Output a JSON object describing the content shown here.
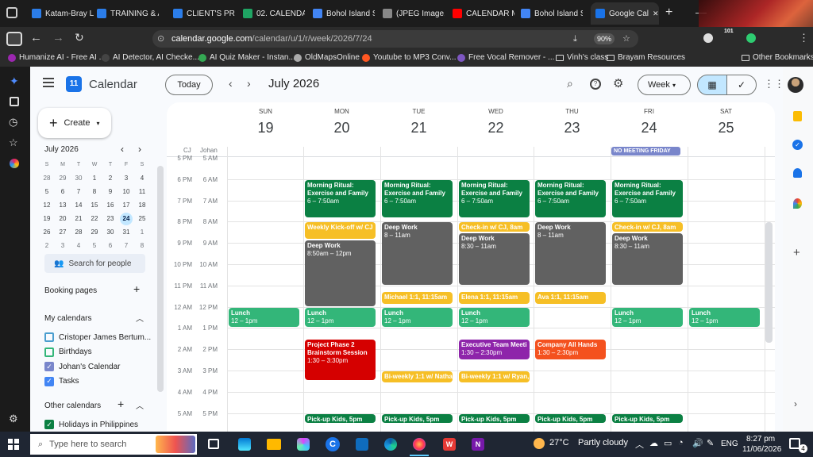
{
  "browser": {
    "tabs": [
      {
        "label": "Katam-Bray La",
        "color": "#2b7de9"
      },
      {
        "label": "TRAINING & A",
        "color": "#2b7de9"
      },
      {
        "label": "CLIENT'S PRO",
        "color": "#2b7de9"
      },
      {
        "label": "02. CALENDAR",
        "color": "#1fa463"
      },
      {
        "label": "Bohol Island S",
        "color": "#4285f4"
      },
      {
        "label": "(JPEG Image, 1024",
        "color": "#888888"
      },
      {
        "label": "CALENDAR M",
        "color": "#ff0000"
      },
      {
        "label": "Bohol Island S",
        "color": "#4285f4"
      },
      {
        "label": "Google Cal",
        "color": "#1a73e8"
      }
    ],
    "url_host": "calendar.google.com",
    "url_path": "/calendar/u/1/r/week/2026/7/24",
    "url_prefix": "",
    "zoom": "90%",
    "bookmarks": [
      "Humanize AI - Free AI ...",
      "AI Detector, AI Checke...",
      "AI Quiz Maker - Instan...",
      "OldMapsOnline",
      "Youtube to MP3 Conv...",
      "Free Vocal Remover - ...",
      "Vinh's class",
      "Brayam Resources",
      "Other Bookmarks"
    ],
    "profile_badge": "101"
  },
  "header": {
    "app_name": "Calendar",
    "logo_day": "11",
    "today_label": "Today",
    "period": "July 2026",
    "view_label": "Week"
  },
  "sidebar": {
    "create_label": "Create",
    "mini_month": "July 2026",
    "weekdays": [
      "S",
      "M",
      "T",
      "W",
      "T",
      "F",
      "S"
    ],
    "weeks": [
      [
        "28",
        "29",
        "30",
        "1",
        "2",
        "3",
        "4"
      ],
      [
        "5",
        "6",
        "7",
        "8",
        "9",
        "10",
        "11"
      ],
      [
        "12",
        "13",
        "14",
        "15",
        "16",
        "17",
        "18"
      ],
      [
        "19",
        "20",
        "21",
        "22",
        "23",
        "24",
        "25"
      ],
      [
        "26",
        "27",
        "28",
        "29",
        "30",
        "31",
        "1"
      ],
      [
        "2",
        "3",
        "4",
        "5",
        "6",
        "7",
        "8"
      ]
    ],
    "selected_day": "24",
    "search_people": "Search for people",
    "booking_pages": "Booking pages",
    "my_calendars_title": "My calendars",
    "my_calendars": [
      {
        "label": "Cristoper James Bertum...",
        "checked": false,
        "color": "#4b9ecf"
      },
      {
        "label": "Birthdays",
        "checked": false,
        "color": "#33b679"
      },
      {
        "label": "Johan's Calendar",
        "checked": true,
        "color": "#7986cb"
      },
      {
        "label": "Tasks",
        "checked": true,
        "color": "#4285f4"
      }
    ],
    "other_calendars_title": "Other calendars",
    "other_calendars": [
      {
        "label": "Holidays in Philippines",
        "checked": true,
        "color": "#0b8043"
      }
    ]
  },
  "grid": {
    "tz_left": "CJ",
    "tz_right": "Johan",
    "days": [
      {
        "dow": "SUN",
        "num": "19"
      },
      {
        "dow": "MON",
        "num": "20"
      },
      {
        "dow": "TUE",
        "num": "21"
      },
      {
        "dow": "WED",
        "num": "22"
      },
      {
        "dow": "THU",
        "num": "23"
      },
      {
        "dow": "FRI",
        "num": "24"
      },
      {
        "dow": "SAT",
        "num": "25"
      }
    ],
    "all_day_event": {
      "label": "NO MEETING FRIDAY",
      "day": 5
    },
    "times_left": [
      "5 PM",
      "6 PM",
      "7 PM",
      "8 PM",
      "9 PM",
      "10 PM",
      "11 PM",
      "12 AM",
      "1 AM",
      "2 AM",
      "3 AM",
      "4 AM",
      "5 AM"
    ],
    "times_right": [
      "5 AM",
      "6 AM",
      "7 AM",
      "8 AM",
      "9 AM",
      "10 AM",
      "11 AM",
      "12 PM",
      "1 PM",
      "2 PM",
      "3 PM",
      "4 PM",
      "5 PM"
    ]
  },
  "events": [
    {
      "day": 1,
      "start": 6,
      "end": 7.833,
      "title": "Morning Ritual: Exercise and Family",
      "time": "6 – 7:50am",
      "color": "#0b8043"
    },
    {
      "day": 2,
      "start": 6,
      "end": 7.833,
      "title": "Morning Ritual: Exercise and Family",
      "time": "6 – 7:50am",
      "color": "#0b8043"
    },
    {
      "day": 3,
      "start": 6,
      "end": 7.833,
      "title": "Morning Ritual: Exercise and Family",
      "time": "6 – 7:50am",
      "color": "#0b8043"
    },
    {
      "day": 4,
      "start": 6,
      "end": 7.833,
      "title": "Morning Ritual: Exercise and Family",
      "time": "6 – 7:50am",
      "color": "#0b8043"
    },
    {
      "day": 5,
      "start": 6,
      "end": 7.833,
      "title": "Morning Ritual: Exercise and Family",
      "time": "6 – 7:50am",
      "color": "#0b8043"
    },
    {
      "day": 1,
      "start": 8,
      "end": 8.833,
      "title": "Weekly Kick-off w/ CJ",
      "time": "",
      "color": "#f6bf26"
    },
    {
      "day": 1,
      "start": 8.833,
      "end": 12,
      "title": "Deep Work",
      "time": "8:50am – 12pm",
      "color": "#616161"
    },
    {
      "day": 2,
      "start": 8,
      "end": 11,
      "title": "Deep Work",
      "time": "8 – 11am",
      "color": "#616161"
    },
    {
      "day": 3,
      "start": 8,
      "end": 8.5,
      "title": "Check-in w/ CJ, 8am",
      "time": "",
      "color": "#f6bf26"
    },
    {
      "day": 3,
      "start": 8.5,
      "end": 11,
      "title": "Deep Work",
      "time": "8:30 – 11am",
      "color": "#616161"
    },
    {
      "day": 4,
      "start": 8,
      "end": 11,
      "title": "Deep Work",
      "time": "8 – 11am",
      "color": "#616161"
    },
    {
      "day": 5,
      "start": 8,
      "end": 8.5,
      "title": "Check-in w/ CJ, 8am",
      "time": "",
      "color": "#f6bf26"
    },
    {
      "day": 5,
      "start": 8.5,
      "end": 11,
      "title": "Deep Work",
      "time": "8:30 – 11am",
      "color": "#616161"
    },
    {
      "day": 2,
      "start": 11.25,
      "end": 11.9,
      "title": "Michael 1:1, 11:15am",
      "time": "",
      "color": "#f6bf26"
    },
    {
      "day": 3,
      "start": 11.25,
      "end": 11.9,
      "title": "Elena 1:1, 11:15am",
      "time": "",
      "color": "#f6bf26"
    },
    {
      "day": 4,
      "start": 11.25,
      "end": 11.9,
      "title": "Ava 1:1, 11:15am",
      "time": "",
      "color": "#f6bf26"
    },
    {
      "day": 0,
      "start": 12,
      "end": 13,
      "title": "Lunch",
      "time": "12 – 1pm",
      "color": "#33b679"
    },
    {
      "day": 1,
      "start": 12,
      "end": 13,
      "title": "Lunch",
      "time": "12 – 1pm",
      "color": "#33b679"
    },
    {
      "day": 2,
      "start": 12,
      "end": 13,
      "title": "Lunch",
      "time": "12 – 1pm",
      "color": "#33b679"
    },
    {
      "day": 3,
      "start": 12,
      "end": 13,
      "title": "Lunch",
      "time": "12 – 1pm",
      "color": "#33b679"
    },
    {
      "day": 5,
      "start": 12,
      "end": 13,
      "title": "Lunch",
      "time": "12 – 1pm",
      "color": "#33b679"
    },
    {
      "day": 6,
      "start": 12,
      "end": 13,
      "title": "Lunch",
      "time": "12 – 1pm",
      "color": "#33b679"
    },
    {
      "day": 1,
      "start": 13.5,
      "end": 15.5,
      "title": "Project Phase 2 Brainstorm Session",
      "time": "1:30 – 3:30pm",
      "color": "#d50000",
      "wrap": true
    },
    {
      "day": 3,
      "start": 13.5,
      "end": 14.5,
      "title": "Executive Team Meeti",
      "time": "1:30 – 2:30pm",
      "color": "#8e24aa"
    },
    {
      "day": 4,
      "start": 13.5,
      "end": 14.5,
      "title": "Company All Hands",
      "time": "1:30 – 2:30pm",
      "color": "#f4511e"
    },
    {
      "day": 2,
      "start": 15,
      "end": 15.6,
      "title": "Bi-weekly 1:1 w/ Natha",
      "time": "",
      "color": "#f6bf26"
    },
    {
      "day": 3,
      "start": 15,
      "end": 15.6,
      "title": "Bi-weekly 1:1 w/ Ryan,",
      "time": "",
      "color": "#f6bf26"
    },
    {
      "day": 1,
      "start": 17,
      "end": 17.5,
      "title": "Pick-up Kids, 5pm",
      "time": "",
      "color": "#0b8043"
    },
    {
      "day": 2,
      "start": 17,
      "end": 17.5,
      "title": "Pick-up Kids, 5pm",
      "time": "",
      "color": "#0b8043"
    },
    {
      "day": 3,
      "start": 17,
      "end": 17.5,
      "title": "Pick-up Kids, 5pm",
      "time": "",
      "color": "#0b8043"
    },
    {
      "day": 4,
      "start": 17,
      "end": 17.5,
      "title": "Pick-up Kids, 5pm",
      "time": "",
      "color": "#0b8043"
    },
    {
      "day": 5,
      "start": 17,
      "end": 17.5,
      "title": "Pick-up Kids, 5pm",
      "time": "",
      "color": "#0b8043"
    }
  ],
  "taskbar": {
    "search_placeholder": "Type here to search",
    "weather_temp": "27°C",
    "weather_desc": "Partly cloudy",
    "lang": "ENG",
    "time": "8:27 pm",
    "date": "11/06/2026",
    "notif_count": "4"
  }
}
